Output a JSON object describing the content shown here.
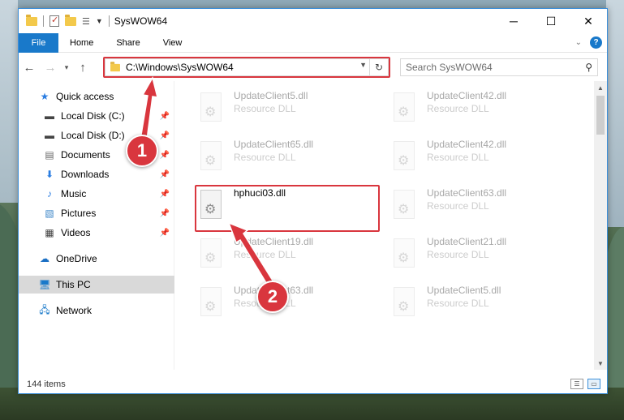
{
  "window": {
    "title": "SysWOW64",
    "controls": {
      "minimize": "─",
      "maximize": "☐",
      "close": "✕"
    }
  },
  "ribbon": {
    "tabs": [
      "File",
      "Home",
      "Share",
      "View"
    ],
    "help": "?"
  },
  "address_bar": {
    "path": "C:\\Windows\\SysWOW64"
  },
  "search": {
    "placeholder": "Search SysWOW64"
  },
  "nav_pane": {
    "items": [
      {
        "label": "Quick access",
        "icon": "star-icon",
        "pinned": false
      },
      {
        "label": "Local Disk (C:)",
        "icon": "drive-icon",
        "pinned": true
      },
      {
        "label": "Local Disk (D:)",
        "icon": "drive-icon",
        "pinned": true
      },
      {
        "label": "Documents",
        "icon": "documents-icon",
        "pinned": true
      },
      {
        "label": "Downloads",
        "icon": "downloads-icon",
        "pinned": true
      },
      {
        "label": "Music",
        "icon": "music-icon",
        "pinned": true
      },
      {
        "label": "Pictures",
        "icon": "pictures-icon",
        "pinned": true
      },
      {
        "label": "Videos",
        "icon": "videos-icon",
        "pinned": true
      },
      {
        "label": "OneDrive",
        "icon": "onedrive-icon",
        "pinned": false
      },
      {
        "label": "This PC",
        "icon": "pc-icon",
        "pinned": false,
        "selected": true
      },
      {
        "label": "Network",
        "icon": "network-icon",
        "pinned": false
      }
    ]
  },
  "files": [
    {
      "name": "UpdateClient5.dll",
      "type": "Resource DLL",
      "faded": true
    },
    {
      "name": "UpdateClient42.dll",
      "type": "Resource DLL",
      "faded": true
    },
    {
      "name": "UpdateClient65.dll",
      "type": "Resource DLL",
      "faded": true
    },
    {
      "name": "UpdateClient42.dll",
      "type": "Resource DLL",
      "faded": true
    },
    {
      "name": "hphuci03.dll",
      "type": "",
      "faded": false
    },
    {
      "name": "UpdateClient63.dll",
      "type": "Resource DLL",
      "faded": true
    },
    {
      "name": "UpdateClient19.dll",
      "type": "Resource DLL",
      "faded": true
    },
    {
      "name": "UpdateClient21.dll",
      "type": "Resource DLL",
      "faded": true
    },
    {
      "name": "UpdateClient63.dll",
      "type": "Resource DLL",
      "faded": true
    },
    {
      "name": "UpdateClient5.dll",
      "type": "Resource DLL",
      "faded": true
    }
  ],
  "status": {
    "item_count": "144 items"
  },
  "annotations": {
    "badge1": "1",
    "badge2": "2",
    "highlight_color": "#d9363e"
  }
}
